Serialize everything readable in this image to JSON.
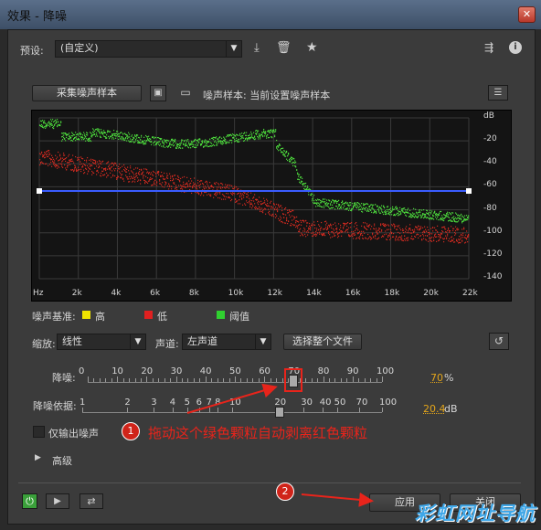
{
  "window": {
    "title": "效果 - 降噪",
    "close_glyph": "✕"
  },
  "preset": {
    "label": "预设:",
    "value": "(自定义)"
  },
  "noise_sample": {
    "capture_button": "采集噪声样本",
    "status": "噪声样本: 当前设置噪声样本"
  },
  "graph": {
    "y_unit": "dB",
    "y_ticks": [
      "dB",
      "-20",
      "-40",
      "-60",
      "-80",
      "-100",
      "-120",
      "-140"
    ],
    "x_ticks": [
      "Hz",
      "2k",
      "4k",
      "6k",
      "8k",
      "10k",
      "12k",
      "14k",
      "16k",
      "18k",
      "20k",
      "22k"
    ]
  },
  "legend": {
    "title": "噪声基准:",
    "items": [
      {
        "label": "高",
        "color": "#f0e400"
      },
      {
        "label": "低",
        "color": "#e02020"
      },
      {
        "label": "阈值",
        "color": "#30d030"
      }
    ]
  },
  "controls": {
    "zoom_label": "缩放:",
    "zoom_value": "线性",
    "channel_label": "声道:",
    "channel_value": "左声道",
    "select_file_button": "选择整个文件"
  },
  "noise_reduction": {
    "label": "降噪:",
    "ticks": [
      "0",
      "10",
      "20",
      "30",
      "40",
      "50",
      "60",
      "70",
      "80",
      "90",
      "100"
    ],
    "first_tick": "0",
    "value": "70",
    "unit": "%",
    "level": 70
  },
  "reduce_by": {
    "label": "降噪依据:",
    "ticks": [
      "1",
      "2",
      "3",
      "4",
      "5",
      "6",
      "7",
      "8",
      "10",
      "20",
      "30",
      "40",
      "50",
      "70",
      "100"
    ],
    "value": "20.4",
    "unit": "dB"
  },
  "output_noise_only": {
    "label": "仅输出噪声",
    "checked": false
  },
  "advanced": {
    "label": "高级"
  },
  "footer": {
    "apply_button": "应用",
    "close_button": "关闭"
  },
  "annotations": {
    "badge1": "1",
    "text1": "拖动这个绿色颗粒自动剥离红色颗粒",
    "badge2": "2"
  },
  "watermark": "彩虹网址导航"
}
